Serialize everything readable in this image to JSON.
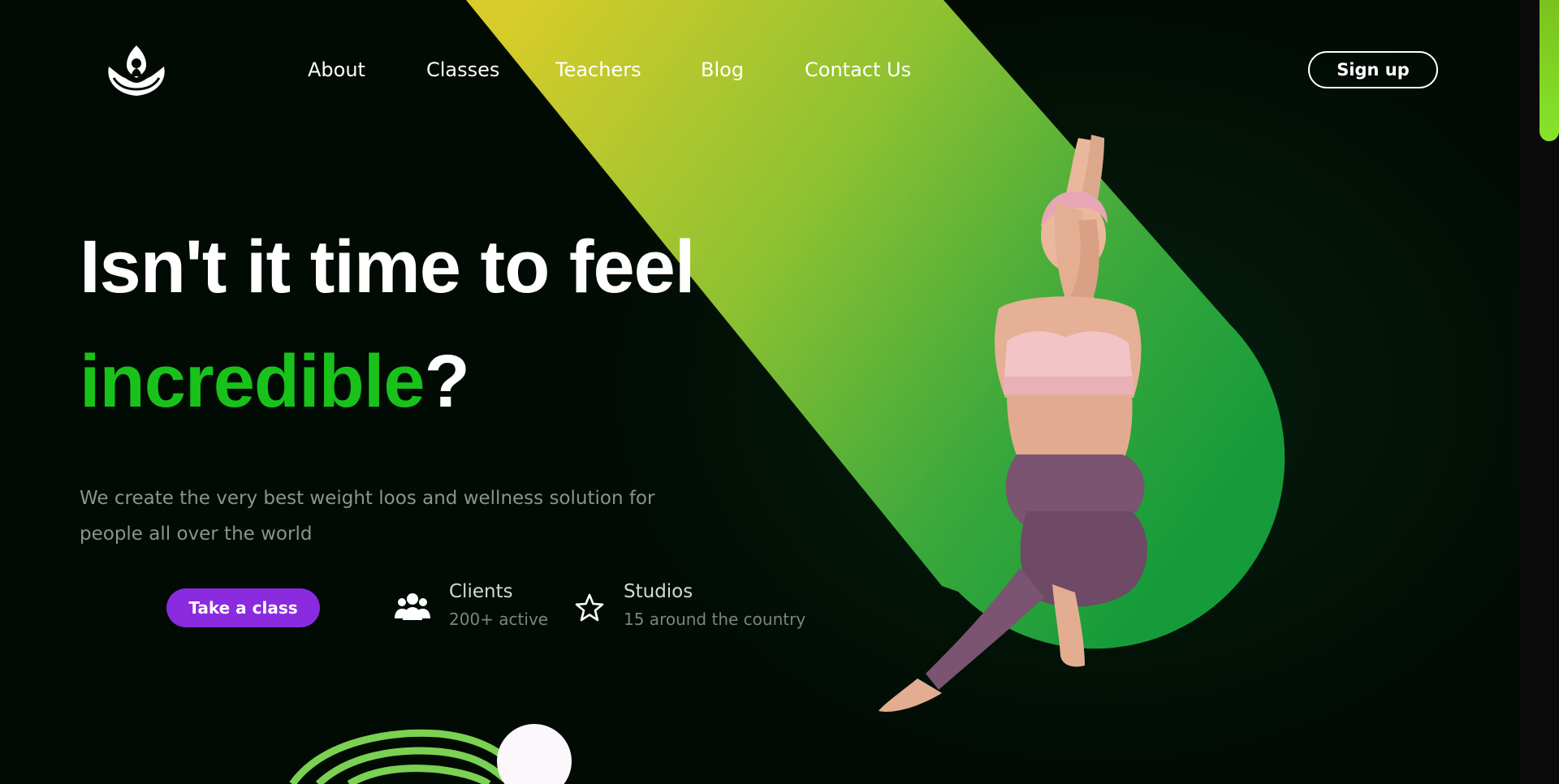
{
  "nav": {
    "items": [
      {
        "label": "About"
      },
      {
        "label": "Classes"
      },
      {
        "label": "Teachers"
      },
      {
        "label": "Blog"
      },
      {
        "label": "Contact Us"
      }
    ],
    "signup_label": "Sign up"
  },
  "logo": {
    "icon": "lotus-meditation-icon"
  },
  "hero": {
    "line1": "Isn't it time to feel",
    "line2_accent": "incredible",
    "line2_rest": "?",
    "description": "We create the very best weight loos and wellness solution for people all over the world",
    "cta_label": "Take a class"
  },
  "stats": [
    {
      "icon": "users-icon",
      "title": "Clients",
      "subtitle": "200+ active"
    },
    {
      "icon": "star-icon",
      "title": "Studios",
      "subtitle": "15 around the country"
    }
  ],
  "colors": {
    "background": "#020a04",
    "accent_green": "#19c21b",
    "button_purple": "#8a2bdf",
    "gradient_start": "#d8cc2a",
    "gradient_end": "#169b3a",
    "scrollbar": "#86e42a"
  }
}
